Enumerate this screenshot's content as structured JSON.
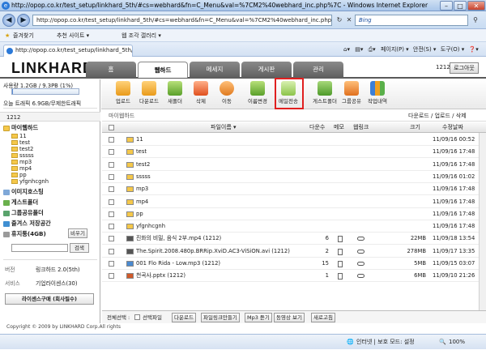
{
  "browser": {
    "title": "http://opop.co.kr/test_setup/linkhard_5th/#cs=webhard&fn=C_Menu&val=%7CM2%40webhard_inc.php%7C - Windows Internet Explorer",
    "address": "http://opop.co.kr/test_setup/linkhard_5th/#cs=webhard&fn=C_Menu&val=%7CM2%40webhard_inc.php%7C",
    "search_placeholder": "Bing",
    "favorites_label": "즐겨찾기",
    "suggested_sites": "추천 사이트 ▾",
    "web_slice": "웹 조각 갤러리 ▾",
    "tab_title": "http://opop.co.kr/test_setup/linkhard_5th/",
    "cmd_page": "페이지(P) ▾",
    "cmd_safety": "안전(S) ▾",
    "cmd_tools": "도구(O) ▾",
    "cmd_help": "❓▾",
    "status_zone": "인터넷 | 보호 모드: 설정",
    "zoom": "100%"
  },
  "site": {
    "logo": "LINKHARD",
    "nav": [
      "홈",
      "웹하드",
      "메세지",
      "게시판",
      "관리"
    ],
    "active_nav": 1,
    "user_count": "1212",
    "logout_label": "로그아웃",
    "copyright": "Copyright © 2009 by LINKHARD Corp.All rights"
  },
  "left": {
    "usage_label": "사용량 1.2GB / 9.3PB (1%)",
    "usage_fraction": 0.01,
    "traffic_label": "오늘 트래픽 6.9GB/무제한트래픽",
    "user_id": "1212",
    "root_folder": "마이웹하드",
    "folders": [
      "11",
      "test",
      "test2",
      "sssss",
      "mp3",
      "mp4",
      "pp",
      "yfgnhcgnh"
    ],
    "sections": [
      "이미지호스팅",
      "게스트폴더",
      "그룹공유폴더",
      "즐겨스 저장공간",
      "휴지통(4GB)"
    ],
    "trash_empty": "비우기",
    "search_btn": "검색",
    "version_label": "버전",
    "version_value": "링크하드 2.0(5th)",
    "service_label": "서비스",
    "service_value": "기업라이센스(30)",
    "license_btn": "라이센스구매 (회사필수)"
  },
  "toolbar": {
    "buttons": [
      "업로드",
      "다운로드",
      "새폴더",
      "삭제",
      "이동",
      "이름변경",
      "메일전송",
      "게스트폴더",
      "그룹공유",
      "작업내역"
    ],
    "highlight_index": 6
  },
  "main": {
    "path": "마이웹하드",
    "path_actions": "다운로드 / 업로드 / 삭제",
    "columns": {
      "name": "파일이름 ▾",
      "count": "다운수",
      "memo": "메모",
      "link": "웹링크",
      "size": "크기",
      "date": "수정날짜"
    },
    "rows": [
      {
        "name": "11",
        "type": "folder",
        "count": "",
        "size": "",
        "date": "11/09/16 00:52"
      },
      {
        "name": "test",
        "type": "folder",
        "count": "",
        "size": "",
        "date": "11/09/16 17:48"
      },
      {
        "name": "test2",
        "type": "folder",
        "count": "",
        "size": "",
        "date": "11/09/16 17:48"
      },
      {
        "name": "sssss",
        "type": "folder",
        "count": "",
        "size": "",
        "date": "11/09/16 01:02"
      },
      {
        "name": "mp3",
        "type": "folder",
        "count": "",
        "size": "",
        "date": "11/09/16 17:48"
      },
      {
        "name": "mp4",
        "type": "folder",
        "count": "",
        "size": "",
        "date": "11/09/16 17:48"
      },
      {
        "name": "pp",
        "type": "folder",
        "count": "",
        "size": "",
        "date": "11/09/16 17:48"
      },
      {
        "name": "yfgnhcgnh",
        "type": "folder",
        "count": "",
        "size": "",
        "date": "11/09/16 17:48"
      },
      {
        "name": "진화의 비밀, 음식 2부.mp4 (1212)",
        "type": "video",
        "count": "6",
        "size": "22MB",
        "date": "11/09/18 13:54"
      },
      {
        "name": "The.Spirit.2008.480p.BRRip.XviD.AC3-ViSiON.avi (1212)",
        "type": "video",
        "count": "2",
        "size": "278MB",
        "date": "11/09/17 13:35"
      },
      {
        "name": "001 Flo Rida - Low.mp3 (1212)",
        "type": "audio",
        "count": "15",
        "size": "5MB",
        "date": "11/09/15 03:07"
      },
      {
        "name": "천곡사.pptx (1212)",
        "type": "doc",
        "count": "1",
        "size": "6MB",
        "date": "11/09/10 21:26"
      }
    ],
    "bottom_label": "전체선택 :",
    "bottom_select": "선택파일",
    "bottom_buttons": [
      "다운로드",
      "파일링크만들기",
      "Mp3 듣기",
      "동영상 보기",
      "새로고침"
    ]
  },
  "colors": {
    "highlight": "#e02020",
    "nav_dark": "#6f6f6f",
    "folder": "#f5c84a"
  }
}
